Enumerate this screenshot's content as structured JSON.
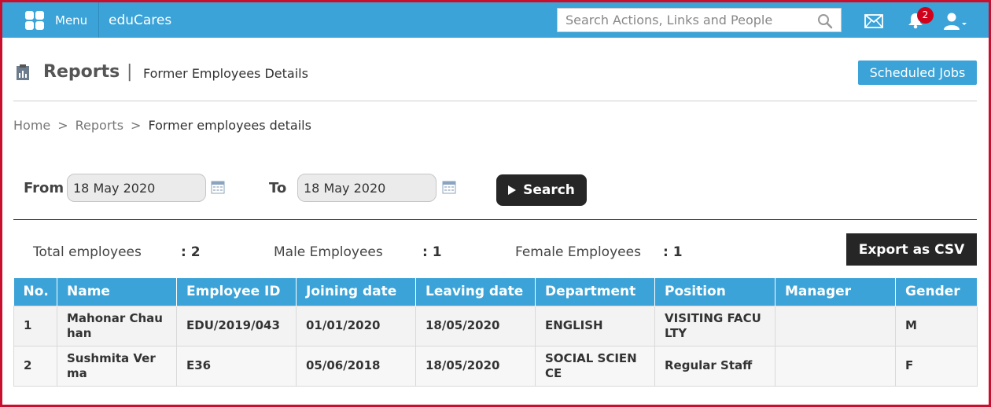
{
  "topbar": {
    "menu_label": "Menu",
    "brand": "eduCares",
    "search_placeholder": "Search Actions, Links and People",
    "notification_count": "2"
  },
  "header": {
    "title": "Reports",
    "separator": "|",
    "subtitle": "Former Employees Details",
    "scheduled_jobs_label": "Scheduled Jobs"
  },
  "breadcrumb": {
    "home": "Home",
    "reports": "Reports",
    "current": "Former employees details",
    "separator": ">"
  },
  "filters": {
    "from_label": "From",
    "from_value": "18 May 2020",
    "to_label": "To",
    "to_value": "18 May 2020",
    "search_label": "Search"
  },
  "stats": {
    "total_label": "Total employees",
    "total_value": ": 2",
    "male_label": "Male Employees",
    "male_value": ": 1",
    "female_label": "Female Employees",
    "female_value": ": 1",
    "export_label": "Export as CSV"
  },
  "table": {
    "headers": [
      "No.",
      "Name",
      "Employee ID",
      "Joining date",
      "Leaving date",
      "Department",
      "Position",
      "Manager",
      "Gender"
    ],
    "rows": [
      [
        "1",
        "Mahonar Chauhan",
        "EDU/2019/043",
        "01/01/2020",
        "18/05/2020",
        "ENGLISH",
        "VISITING FACULTY",
        "",
        "M"
      ],
      [
        "2",
        "Sushmita Verma",
        "E36",
        "05/06/2018",
        "18/05/2020",
        "SOCIAL SCIENCE",
        "Regular Staff",
        "",
        "F"
      ]
    ]
  },
  "colors": {
    "topbar": "#3ba3d8",
    "frame": "#c8102e",
    "dark_button": "#262626",
    "badge": "#d0021b"
  },
  "icons": [
    "menu-grid-icon",
    "search-icon",
    "mail-icon",
    "bell-icon",
    "user-icon",
    "report-icon",
    "calendar-icon",
    "play-icon"
  ]
}
